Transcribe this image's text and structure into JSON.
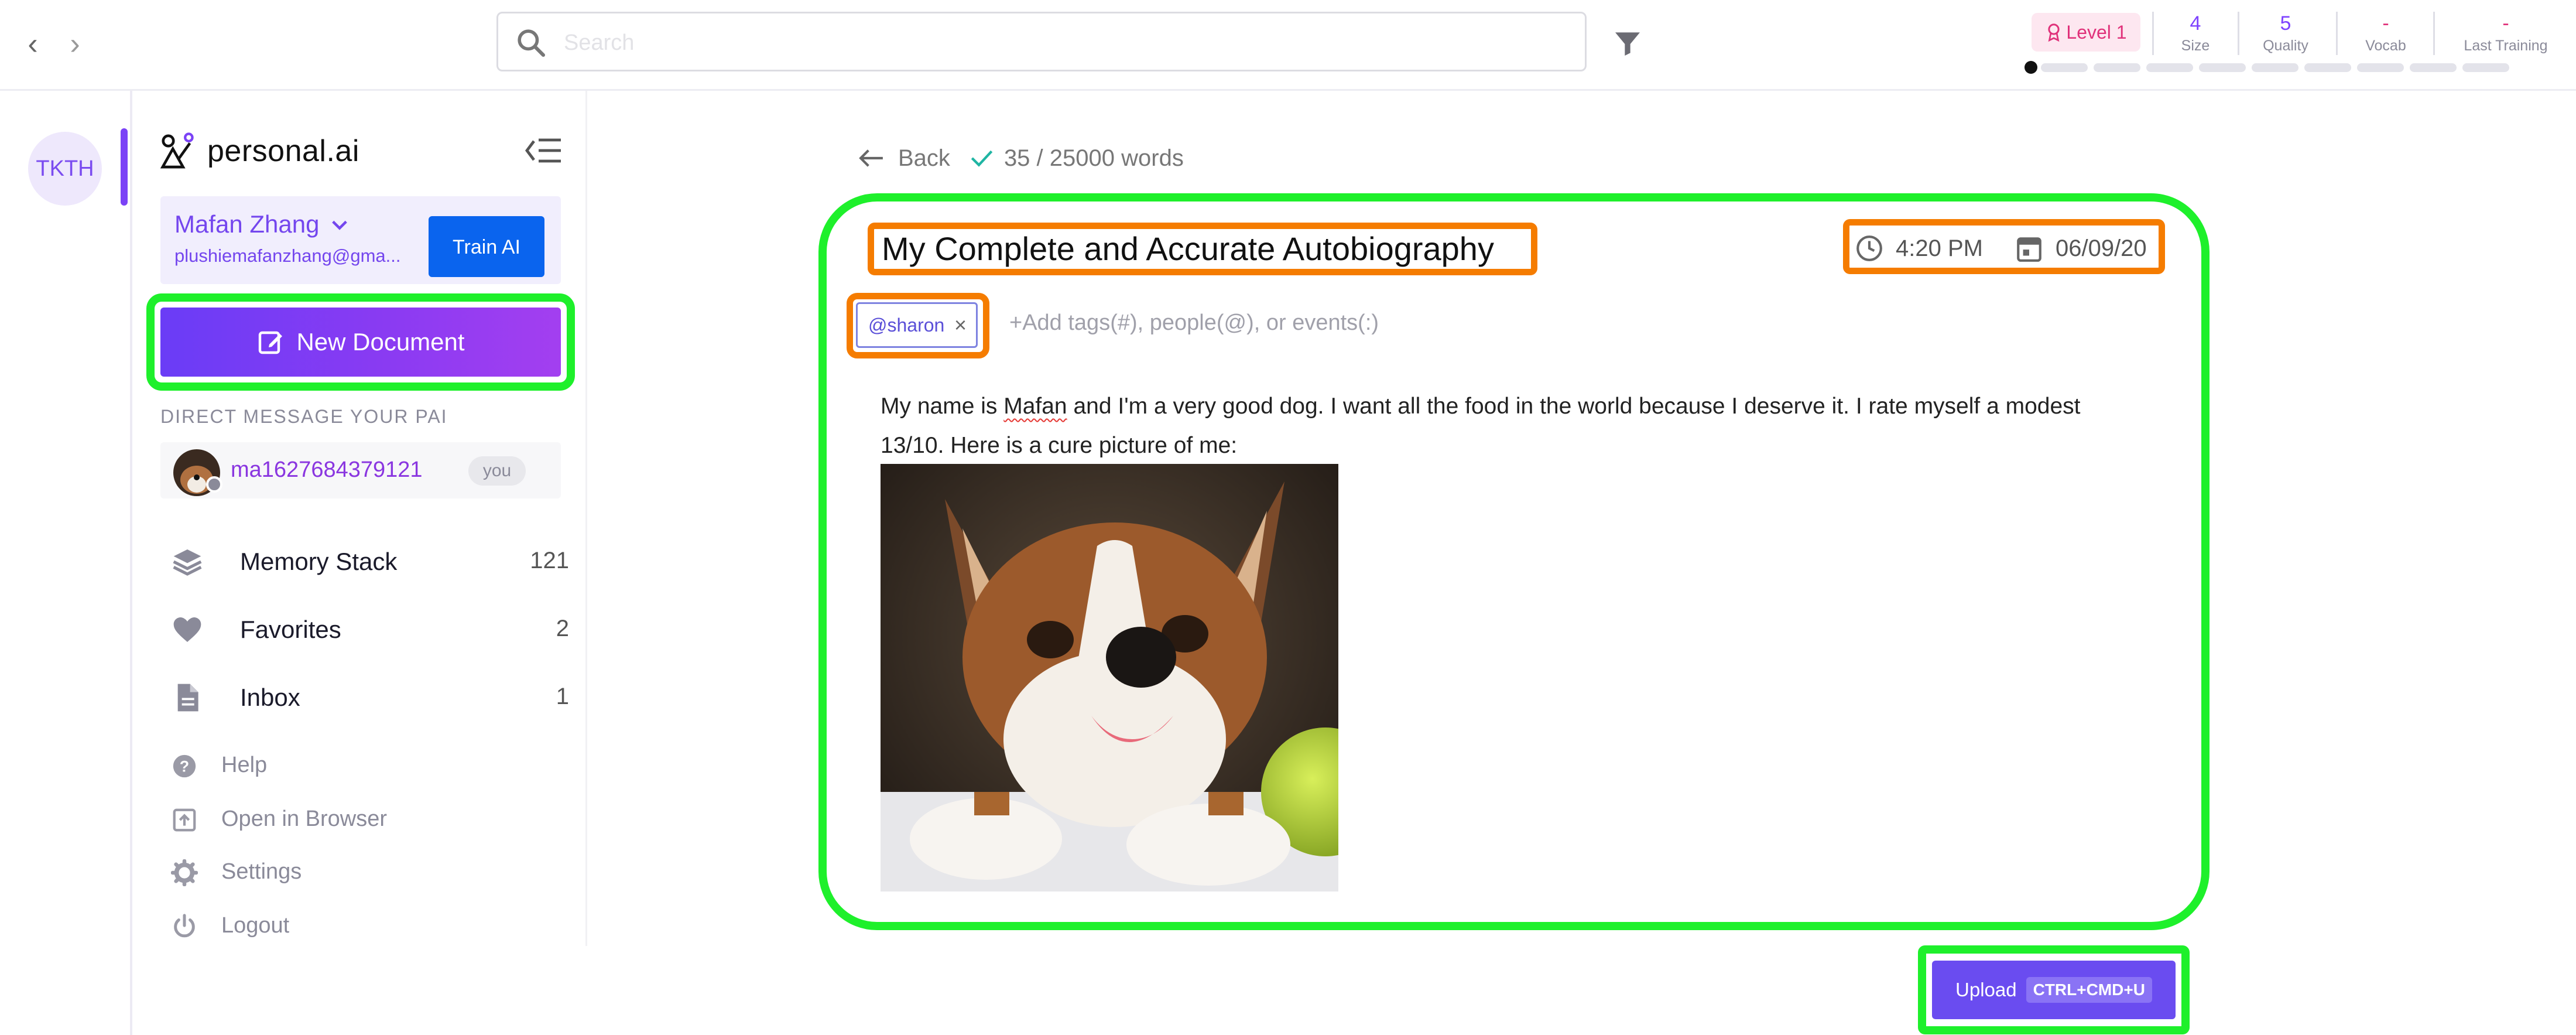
{
  "toolbar": {
    "back_arrow": "‹",
    "forward_arrow": "›",
    "search_placeholder": "Search"
  },
  "stats": {
    "level": "Level 1",
    "items": [
      {
        "value": "4",
        "label": "Size"
      },
      {
        "value": "5",
        "label": "Quality"
      },
      {
        "value": "-",
        "label": "Vocab"
      },
      {
        "value": "-",
        "label": "Last Training"
      }
    ],
    "progress_segments_total": 10,
    "progress_segments_done": 1
  },
  "rail": {
    "avatar_initials": "TKTH"
  },
  "sidebar": {
    "logo_text": "personal.ai",
    "user_name": "Mafan Zhang",
    "user_email": "plushiemafanzhang@gma...",
    "train_label": "Train AI",
    "new_document_label": "New Document",
    "dm_heading": "DIRECT MESSAGE YOUR PAI",
    "dm_user": "ma1627684379121",
    "dm_you": "you",
    "menu": [
      {
        "label": "Memory Stack",
        "count": "121",
        "icon": "layers-icon"
      },
      {
        "label": "Favorites",
        "count": "2",
        "icon": "heart-icon"
      },
      {
        "label": "Inbox",
        "count": "1",
        "icon": "document-icon"
      }
    ],
    "sub_menu": [
      {
        "label": "Help",
        "icon": "help-icon"
      },
      {
        "label": "Open in Browser",
        "icon": "open-browser-icon"
      },
      {
        "label": "Settings",
        "icon": "gear-icon"
      },
      {
        "label": "Logout",
        "icon": "power-icon"
      }
    ]
  },
  "document": {
    "back_label": "Back",
    "word_count": "35 / 25000 words",
    "title": "My Complete and Accurate Autobiography",
    "time": "4:20 PM",
    "date": "06/09/20",
    "tag": "@sharon",
    "tag_remove": "×",
    "tag_placeholder": "+Add tags(#), people(@), or events(:)",
    "body_before": "My name is ",
    "body_misspelled": "Mafan",
    "body_after": " and I'm a very good dog. I want all the food in the world because I deserve it. I rate myself a modest 13/10. Here is a cure picture of me:",
    "upload_label": "Upload",
    "upload_shortcut": "CTRL+CMD+U"
  },
  "colors": {
    "accent": "#7446ee",
    "highlight_green": "#1ef02b",
    "highlight_orange": "#f57c00",
    "train_button": "#0a64ee"
  }
}
